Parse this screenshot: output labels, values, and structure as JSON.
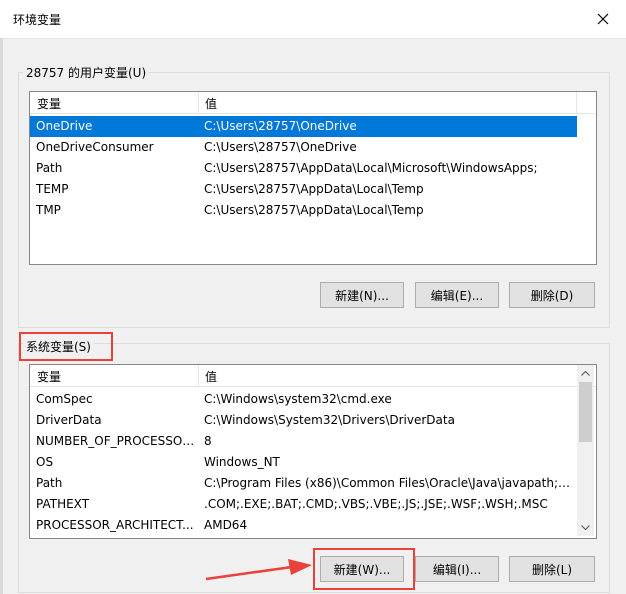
{
  "window": {
    "title": "环境变量"
  },
  "user_vars": {
    "group_label": "28757 的用户变量(U)",
    "columns": [
      "变量",
      "值"
    ],
    "rows": [
      [
        "OneDrive",
        "C:\\Users\\28757\\OneDrive"
      ],
      [
        "OneDriveConsumer",
        "C:\\Users\\28757\\OneDrive"
      ],
      [
        "Path",
        "C:\\Users\\28757\\AppData\\Local\\Microsoft\\WindowsApps;"
      ],
      [
        "TEMP",
        "C:\\Users\\28757\\AppData\\Local\\Temp"
      ],
      [
        "TMP",
        "C:\\Users\\28757\\AppData\\Local\\Temp"
      ]
    ],
    "selected_index": 0,
    "buttons": {
      "new": "新建(N)...",
      "edit": "编辑(E)...",
      "delete": "删除(D)"
    }
  },
  "system_vars": {
    "group_label": "系统变量(S)",
    "columns": [
      "变量",
      "值"
    ],
    "rows": [
      [
        "ComSpec",
        "C:\\Windows\\system32\\cmd.exe"
      ],
      [
        "DriverData",
        "C:\\Windows\\System32\\Drivers\\DriverData"
      ],
      [
        "NUMBER_OF_PROCESSORS",
        "8"
      ],
      [
        "OS",
        "Windows_NT"
      ],
      [
        "Path",
        "C:\\Program Files (x86)\\Common Files\\Oracle\\Java\\javapath;C:..."
      ],
      [
        "PATHEXT",
        ".COM;.EXE;.BAT;.CMD;.VBS;.VBE;.JS;.JSE;.WSF;.WSH;.MSC"
      ],
      [
        "PROCESSOR_ARCHITECT...",
        "AMD64"
      ]
    ],
    "buttons": {
      "new": "新建(W)...",
      "edit": "编辑(I)...",
      "delete": "删除(L)"
    }
  },
  "icons": {
    "close": "close-icon",
    "scroll_up": "scroll-up-arrow-icon",
    "scroll_down": "scroll-down-arrow-icon",
    "pointer": "red-arrow-icon"
  },
  "colors": {
    "selection": "#0078d7",
    "annotation": "#e8423b"
  }
}
